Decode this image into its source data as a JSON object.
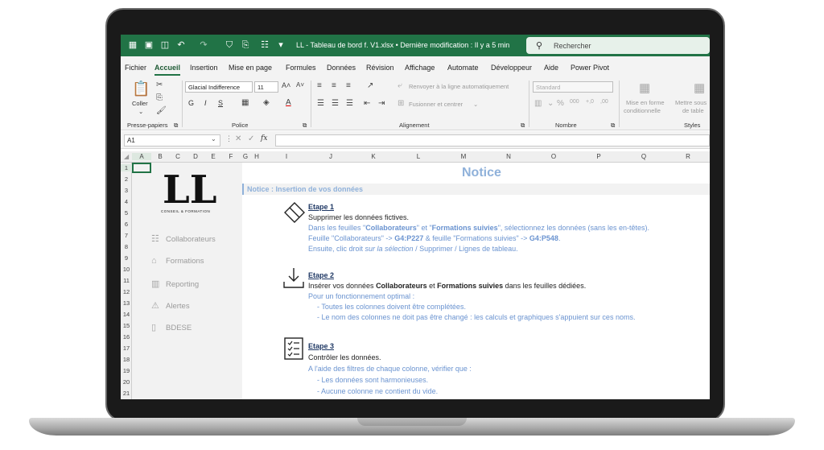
{
  "window": {
    "title": "LL - Tableau de bord f. V1.xlsx • Dernière modification : Il y a 5 min",
    "search_placeholder": "Rechercher",
    "accent_color": "#217346"
  },
  "menu": {
    "tabs": [
      "Fichier",
      "Accueil",
      "Insertion",
      "Mise en page",
      "Formules",
      "Données",
      "Révision",
      "Affichage",
      "Automate",
      "Développeur",
      "Aide",
      "Power Pivot"
    ],
    "active_tab": "Accueil"
  },
  "ribbon": {
    "clipboard": {
      "paste_label": "Coller",
      "group_label": "Presse-papiers"
    },
    "font": {
      "font_name": "Glacial Indifference",
      "font_size": "11",
      "bold": "G",
      "italic": "I",
      "underline": "S",
      "group_label": "Police"
    },
    "alignment": {
      "wrap_text": "Renvoyer à la ligne automatiquement",
      "merge_center": "Fusionner et centrer",
      "group_label": "Alignement"
    },
    "number": {
      "format": "Standard",
      "group_label": "Nombre"
    },
    "styles": {
      "conditional_1": "Mise en forme",
      "conditional_2": "conditionnelle",
      "table_1": "Mettre sous",
      "table_2": "de table",
      "group_label": "Styles"
    }
  },
  "formula_bar": {
    "name_box": "A1",
    "fx": "fx"
  },
  "columns": [
    "A",
    "B",
    "C",
    "D",
    "E",
    "F",
    "G",
    "H",
    "I",
    "J",
    "K",
    "L",
    "M",
    "N",
    "O",
    "P",
    "Q",
    "R"
  ],
  "rows": [
    "1",
    "2",
    "3",
    "4",
    "5",
    "6",
    "7",
    "8",
    "9",
    "10",
    "11",
    "12",
    "13",
    "14",
    "15",
    "16",
    "17",
    "18",
    "19",
    "20",
    "21"
  ],
  "sidebar": {
    "logo_text": "LL",
    "logo_tagline": "CONSEIL & FORMATION",
    "items": [
      {
        "label": "Collaborateurs",
        "icon": "people-icon"
      },
      {
        "label": "Formations",
        "icon": "graduation-cap-icon"
      },
      {
        "label": "Reporting",
        "icon": "bar-chart-icon"
      },
      {
        "label": "Alertes",
        "icon": "alarm-icon"
      },
      {
        "label": "BDESE",
        "icon": "document-icon"
      }
    ]
  },
  "notice": {
    "title": "Notice",
    "subtitle": "Notice : Insertion de vos données",
    "step1": {
      "title": "Etape 1",
      "l1": "Supprimer les données fictives.",
      "l2a": "Dans les feuilles \"",
      "l2b": "Collaborateurs",
      "l2c": "\" et \"",
      "l2d": "Formations suivies",
      "l2e": "\", sélectionnez les données (sans les en-têtes).",
      "l3a": "Feuille \"Collaborateurs\" -> ",
      "l3b": "G4:P227",
      "l3c": " & feuille \"Formations suivies\"  -> ",
      "l3d": "G4:P548",
      "l3e": ".",
      "l4a": "Ensuite, clic droit ",
      "l4b": "sur la sélection",
      "l4c": "  / Supprimer / Lignes de tableau."
    },
    "step2": {
      "title": "Etape 2",
      "l1a": "Insérer vos données ",
      "l1b": "Collaborateurs",
      "l1c": " et ",
      "l1d": "Formations suivies",
      "l1e": " dans les feuilles dédiées.",
      "l2": "Pour un fonctionnement optimal :",
      "l3": "-  Toutes les colonnes doivent être complétées.",
      "l4": "-  Le nom des colonnes ne doit pas être changé : les calculs et graphiques s'appuient sur ces noms."
    },
    "step3": {
      "title": "Etape 3",
      "l1": "Contrôler les données.",
      "l2": "A l'aide des filtres de chaque colonne, vérifier que :",
      "l3": "-  Les données sont harmonieuses.",
      "l4": "-  Aucune colonne ne contient du vide."
    }
  }
}
